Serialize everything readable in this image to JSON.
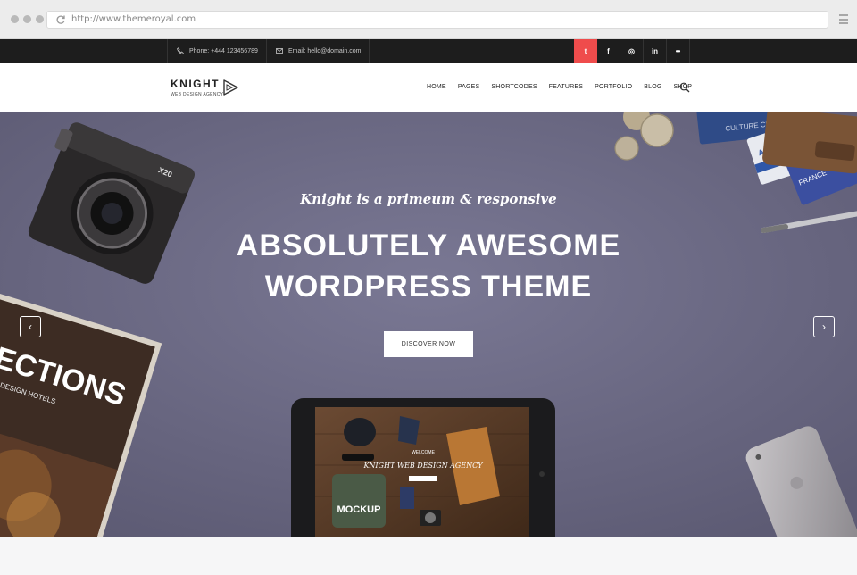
{
  "browser": {
    "url": "http://www.themeroyal.com"
  },
  "topbar": {
    "phone": "Phone: +444 123456789",
    "email": "Email: hello@domain.com",
    "socials": [
      {
        "icon": "twitter-icon",
        "glyph": "t"
      },
      {
        "icon": "facebook-icon",
        "glyph": "f"
      },
      {
        "icon": "dribbble-icon",
        "glyph": "◎"
      },
      {
        "icon": "linkedin-icon",
        "glyph": "in"
      },
      {
        "icon": "flickr-icon",
        "glyph": "••"
      }
    ],
    "accent": "#ef4c4c"
  },
  "header": {
    "logo_title": "KNIGHT",
    "logo_sub": "WEB DESIGN AGENCY",
    "nav": [
      "HOME",
      "PAGES",
      "SHORTCODES",
      "FEATURES",
      "PORTFOLIO",
      "BLOG",
      "SHOP"
    ]
  },
  "hero": {
    "subtitle": "Knight is a primeum & responsive",
    "title_line1": "ABSOLUTELY AWESOME",
    "title_line2": "WORDPRESS THEME",
    "cta": "DISCOVER NOW",
    "prev": "‹",
    "next": "›",
    "props": {
      "magazine": "RECTIONS",
      "magazine_sub": "AZINE by DESIGN HOTELS",
      "tablet_welcome": "WELCOME",
      "tablet_title": "KNIGHT WEB DESIGN AGENCY",
      "tablet_tee": "MOCKUP",
      "camera_brand": "X20",
      "card_top": "CULTURE CLUB",
      "card_airline": "AERO",
      "card_airline2": "FRANCE"
    }
  }
}
